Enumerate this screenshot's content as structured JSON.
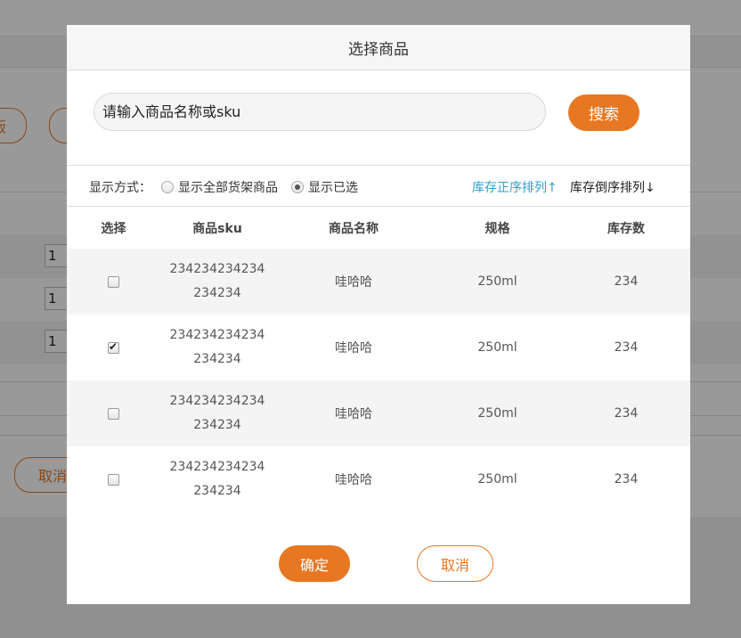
{
  "background": {
    "button_partial": "版",
    "qty_values": [
      "1",
      "1",
      "1"
    ],
    "cancel_label": "取消"
  },
  "modal": {
    "title": "选择商品",
    "search": {
      "placeholder": "请输入商品名称或sku",
      "button_label": "搜索"
    },
    "display": {
      "label": "显示方式：",
      "options": [
        {
          "label": "显示全部货架商品",
          "selected": false
        },
        {
          "label": "显示已选",
          "selected": true
        }
      ],
      "sort_asc": "库存正序排列↑",
      "sort_desc": "库存倒序排列↓"
    },
    "table": {
      "headers": [
        "选择",
        "商品sku",
        "商品名称",
        "规格",
        "库存数"
      ],
      "rows": [
        {
          "checked": false,
          "sku_line1": "234234234234",
          "sku_line2": "234234",
          "name": "哇哈哈",
          "spec": "250ml",
          "stock": "234"
        },
        {
          "checked": true,
          "sku_line1": "234234234234",
          "sku_line2": "234234",
          "name": "哇哈哈",
          "spec": "250ml",
          "stock": "234"
        },
        {
          "checked": false,
          "sku_line1": "234234234234",
          "sku_line2": "234234",
          "name": "哇哈哈",
          "spec": "250ml",
          "stock": "234"
        },
        {
          "checked": false,
          "sku_line1": "234234234234",
          "sku_line2": "234234",
          "name": "哇哈哈",
          "spec": "250ml",
          "stock": "234"
        }
      ]
    },
    "confirm_label": "确定",
    "cancel_label": "取消"
  },
  "colors": {
    "accent": "#e87722",
    "link": "#2aa0d6"
  }
}
